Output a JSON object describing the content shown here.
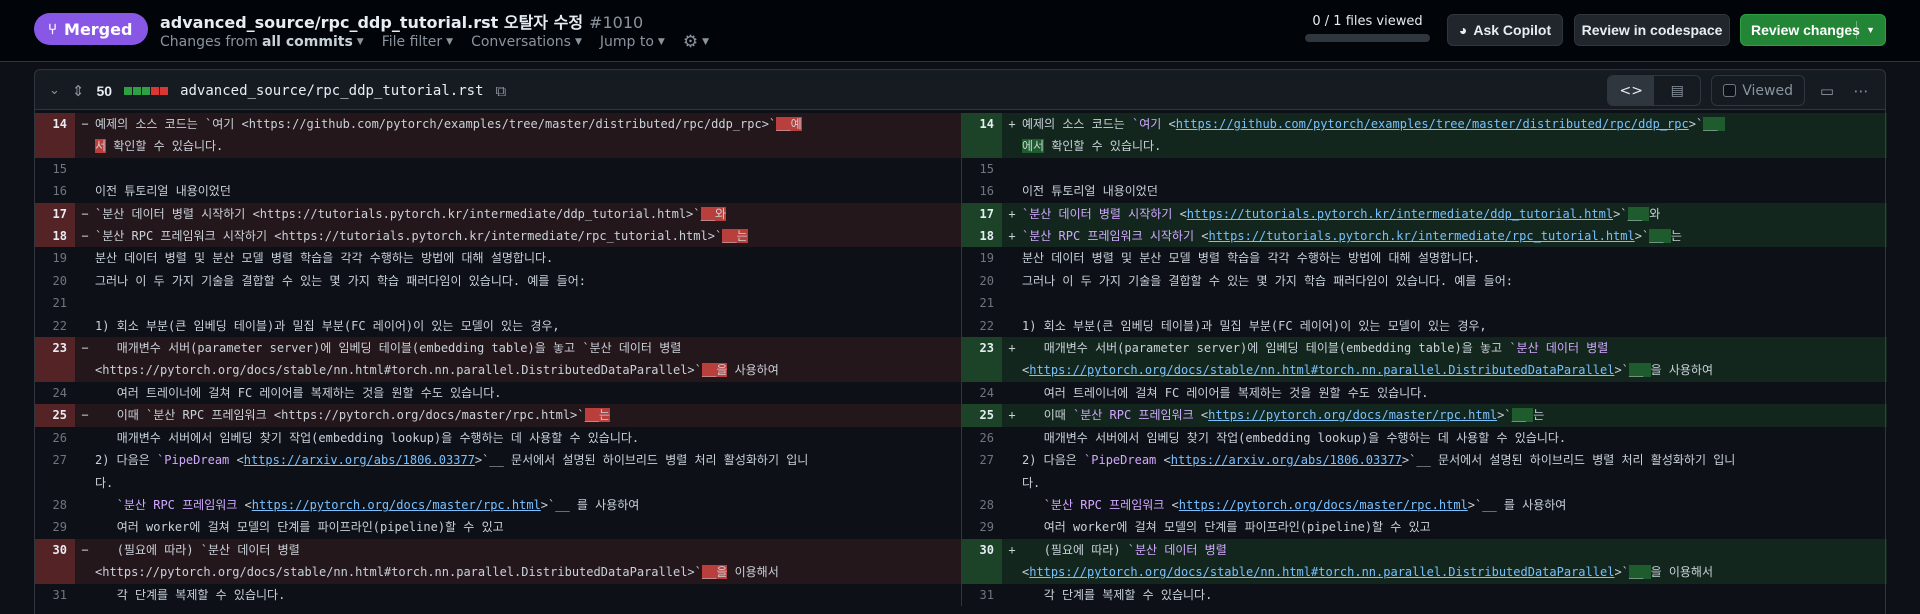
{
  "pr": {
    "status_label": "Merged",
    "title": "advanced_source/rpc_ddp_tutorial.rst 오탈자 수정",
    "number": "#1010",
    "changes_from_prefix": "Changes from",
    "changes_from_value": "all commits",
    "file_filter": "File filter",
    "conversations": "Conversations",
    "jump_to": "Jump to",
    "files_viewed": "0 / 1 files viewed",
    "files_viewed_fraction": 0,
    "ask_copilot": "Ask Copilot",
    "review_codespace": "Review in codespace",
    "review_changes": "Review changes"
  },
  "file": {
    "changes": "50",
    "path": "advanced_source/rpc_ddp_tutorial.rst",
    "viewed_label": "Viewed",
    "diffstat": [
      "#2ea043",
      "#2ea043",
      "#2ea043",
      "#da3633",
      "#da3633"
    ]
  },
  "colors": {
    "merged": "#8957e5",
    "review": "#238636",
    "added": "#2ea043",
    "removed": "#da3633"
  },
  "diff": {
    "left": [
      {
        "num": "14",
        "type": "del",
        "mark": "−",
        "segs": [
          {
            "t": "예제의 소스 코드는 `여기 <https://github.com/pytorch/examples/tree/master/distributed/rpc/ddp_rpc>`"
          },
          {
            "t": "__예",
            "c": "hl-del"
          },
          {
            "t": "\n"
          },
          {
            "t": "서",
            "c": "hl-del"
          },
          {
            "t": " 확인할 수 있습니다."
          }
        ]
      },
      {
        "num": "15",
        "type": "ctx",
        "mark": "",
        "segs": [
          {
            "t": ""
          }
        ]
      },
      {
        "num": "16",
        "type": "ctx",
        "mark": "",
        "segs": [
          {
            "t": "이전 튜토리얼 내용이었던"
          }
        ]
      },
      {
        "num": "17",
        "type": "del",
        "mark": "−",
        "segs": [
          {
            "t": "`분산 데이터 병렬 시작하기 <https://tutorials.pytorch.kr/intermediate/ddp_tutorial.html>`"
          },
          {
            "t": "__와",
            "c": "hl-del"
          }
        ]
      },
      {
        "num": "18",
        "type": "del",
        "mark": "−",
        "segs": [
          {
            "t": "`분산 RPC 프레임워크 시작하기 <https://tutorials.pytorch.kr/intermediate/rpc_tutorial.html>`"
          },
          {
            "t": "__는",
            "c": "hl-del"
          }
        ]
      },
      {
        "num": "19",
        "type": "ctx",
        "mark": "",
        "segs": [
          {
            "t": "분산 데이터 병렬 및 분산 모델 병렬 학습을 각각 수행하는 방법에 대해 설명합니다."
          }
        ]
      },
      {
        "num": "20",
        "type": "ctx",
        "mark": "",
        "segs": [
          {
            "t": "그러나 이 두 가지 기술을 결합할 수 있는 몇 가지 학습 패러다임이 있습니다. 예를 들어:"
          }
        ]
      },
      {
        "num": "21",
        "type": "ctx",
        "mark": "",
        "segs": [
          {
            "t": ""
          }
        ]
      },
      {
        "num": "22",
        "type": "ctx",
        "mark": "",
        "segs": [
          {
            "t": "1) 회소 부분(큰 임베딩 테이블)과 밀집 부분(FC 레이어)이 있는 모델이 있는 경우,"
          }
        ]
      },
      {
        "num": "23",
        "type": "del",
        "mark": "−",
        "segs": [
          {
            "t": "   매개변수 서버(parameter server)에 임베딩 테이블(embedding table)을 놓고 `분산 데이터 병렬\n<https://pytorch.org/docs/stable/nn.html#torch.nn.parallel.DistributedDataParallel>`"
          },
          {
            "t": "__을",
            "c": "hl-del"
          },
          {
            "t": " 사용하여"
          }
        ]
      },
      {
        "num": "24",
        "type": "ctx",
        "mark": "",
        "segs": [
          {
            "t": "   여러 트레이너에 걸쳐 FC 레이어를 복제하는 것을 원할 수도 있습니다."
          }
        ]
      },
      {
        "num": "25",
        "type": "del",
        "mark": "−",
        "segs": [
          {
            "t": "   이때 `분산 RPC 프레임워크 <https://pytorch.org/docs/master/rpc.html>`"
          },
          {
            "t": "__는",
            "c": "hl-del"
          }
        ]
      },
      {
        "num": "26",
        "type": "ctx",
        "mark": "",
        "segs": [
          {
            "t": "   매개변수 서버에서 임베딩 찾기 작업(embedding lookup)을 수행하는 데 사용할 수 있습니다."
          }
        ]
      },
      {
        "num": "27",
        "type": "ctx",
        "mark": "",
        "segs": [
          {
            "t": "2) 다음은 "
          },
          {
            "t": "`PipeDream",
            "c": "str"
          },
          {
            "t": " <"
          },
          {
            "t": "https://arxiv.org/abs/1806.03377",
            "c": "lnk"
          },
          {
            "t": ">`__ 문서에서 설명된 하이브리드 병렬 처리 활성화하기 입니\n다."
          }
        ]
      },
      {
        "num": "28",
        "type": "ctx",
        "mark": "",
        "segs": [
          {
            "t": "   "
          },
          {
            "t": "`분산 RPC 프레임워크",
            "c": "str"
          },
          {
            "t": " <"
          },
          {
            "t": "https://pytorch.org/docs/master/rpc.html",
            "c": "lnk"
          },
          {
            "t": ">`__ 를 사용하여"
          }
        ]
      },
      {
        "num": "29",
        "type": "ctx",
        "mark": "",
        "segs": [
          {
            "t": "   여러 worker에 걸쳐 모델의 단계를 파이프라인(pipeline)할 수 있고"
          }
        ]
      },
      {
        "num": "30",
        "type": "del",
        "mark": "−",
        "segs": [
          {
            "t": "   (필요에 따라) `분산 데이터 병렬\n<https://pytorch.org/docs/stable/nn.html#torch.nn.parallel.DistributedDataParallel>`"
          },
          {
            "t": "__을",
            "c": "hl-del"
          },
          {
            "t": " 이용해서"
          }
        ]
      },
      {
        "num": "31",
        "type": "ctx",
        "mark": "",
        "segs": [
          {
            "t": "   각 단계를 복제할 수 있습니다."
          }
        ]
      }
    ],
    "right": [
      {
        "num": "14",
        "type": "add",
        "mark": "+",
        "segs": [
          {
            "t": "예제의 소스 코드는 "
          },
          {
            "t": "`여기",
            "c": "str"
          },
          {
            "t": " <"
          },
          {
            "t": "https://github.com/pytorch/examples/tree/master/distributed/rpc/ddp_rpc",
            "c": "lnk"
          },
          {
            "t": ">`"
          },
          {
            "t": "__ ",
            "c": "hl-add"
          },
          {
            "t": "\n"
          },
          {
            "t": "에서",
            "c": "hl-add"
          },
          {
            "t": " 확인할 수 있습니다."
          }
        ]
      },
      {
        "num": "15",
        "type": "ctx",
        "mark": "",
        "segs": [
          {
            "t": ""
          }
        ]
      },
      {
        "num": "16",
        "type": "ctx",
        "mark": "",
        "segs": [
          {
            "t": "이전 튜토리얼 내용이었던"
          }
        ]
      },
      {
        "num": "17",
        "type": "add",
        "mark": "+",
        "segs": [
          {
            "t": "`분산 데이터 병렬 시작하기",
            "c": "str"
          },
          {
            "t": " <"
          },
          {
            "t": "https://tutorials.pytorch.kr/intermediate/ddp_tutorial.html",
            "c": "lnk"
          },
          {
            "t": ">`"
          },
          {
            "t": "__ ",
            "c": "hl-add"
          },
          {
            "t": "와"
          }
        ]
      },
      {
        "num": "18",
        "type": "add",
        "mark": "+",
        "segs": [
          {
            "t": "`분산 RPC 프레임워크 시작하기",
            "c": "str"
          },
          {
            "t": " <"
          },
          {
            "t": "https://tutorials.pytorch.kr/intermediate/rpc_tutorial.html",
            "c": "lnk"
          },
          {
            "t": ">`"
          },
          {
            "t": "__ ",
            "c": "hl-add"
          },
          {
            "t": "는"
          }
        ]
      },
      {
        "num": "19",
        "type": "ctx",
        "mark": "",
        "segs": [
          {
            "t": "분산 데이터 병렬 및 분산 모델 병렬 학습을 각각 수행하는 방법에 대해 설명합니다."
          }
        ]
      },
      {
        "num": "20",
        "type": "ctx",
        "mark": "",
        "segs": [
          {
            "t": "그러나 이 두 가지 기술을 결합할 수 있는 몇 가지 학습 패러다임이 있습니다. 예를 들어:"
          }
        ]
      },
      {
        "num": "21",
        "type": "ctx",
        "mark": "",
        "segs": [
          {
            "t": ""
          }
        ]
      },
      {
        "num": "22",
        "type": "ctx",
        "mark": "",
        "segs": [
          {
            "t": "1) 회소 부분(큰 임베딩 테이블)과 밀집 부분(FC 레이어)이 있는 모델이 있는 경우,"
          }
        ]
      },
      {
        "num": "23",
        "type": "add",
        "mark": "+",
        "segs": [
          {
            "t": "   매개변수 서버(parameter server)에 임베딩 테이블(embedding table)을 놓고 "
          },
          {
            "t": "`분산 데이터 병렬",
            "c": "str"
          },
          {
            "t": "\n<"
          },
          {
            "t": "https://pytorch.org/docs/stable/nn.html#torch.nn.parallel.DistributedDataParallel",
            "c": "lnk"
          },
          {
            "t": ">`"
          },
          {
            "t": "__ ",
            "c": "hl-add"
          },
          {
            "t": "을 사용하여"
          }
        ]
      },
      {
        "num": "24",
        "type": "ctx",
        "mark": "",
        "segs": [
          {
            "t": "   여러 트레이너에 걸쳐 FC 레이어를 복제하는 것을 원할 수도 있습니다."
          }
        ]
      },
      {
        "num": "25",
        "type": "add",
        "mark": "+",
        "segs": [
          {
            "t": "   이때 "
          },
          {
            "t": "`분산 RPC 프레임워크",
            "c": "str"
          },
          {
            "t": " <"
          },
          {
            "t": "https://pytorch.org/docs/master/rpc.html",
            "c": "lnk"
          },
          {
            "t": ">`"
          },
          {
            "t": "__ ",
            "c": "hl-add"
          },
          {
            "t": "는"
          }
        ]
      },
      {
        "num": "26",
        "type": "ctx",
        "mark": "",
        "segs": [
          {
            "t": "   매개변수 서버에서 임베딩 찾기 작업(embedding lookup)을 수행하는 데 사용할 수 있습니다."
          }
        ]
      },
      {
        "num": "27",
        "type": "ctx",
        "mark": "",
        "segs": [
          {
            "t": "2) 다음은 "
          },
          {
            "t": "`PipeDream",
            "c": "str"
          },
          {
            "t": " <"
          },
          {
            "t": "https://arxiv.org/abs/1806.03377",
            "c": "lnk"
          },
          {
            "t": ">`__ 문서에서 설명된 하이브리드 병렬 처리 활성화하기 입니\n다."
          }
        ]
      },
      {
        "num": "28",
        "type": "ctx",
        "mark": "",
        "segs": [
          {
            "t": "   "
          },
          {
            "t": "`분산 RPC 프레임워크",
            "c": "str"
          },
          {
            "t": " <"
          },
          {
            "t": "https://pytorch.org/docs/master/rpc.html",
            "c": "lnk"
          },
          {
            "t": ">`__ 를 사용하여"
          }
        ]
      },
      {
        "num": "29",
        "type": "ctx",
        "mark": "",
        "segs": [
          {
            "t": "   여러 worker에 걸쳐 모델의 단계를 파이프라인(pipeline)할 수 있고"
          }
        ]
      },
      {
        "num": "30",
        "type": "add",
        "mark": "+",
        "segs": [
          {
            "t": "   (필요에 따라) "
          },
          {
            "t": "`분산 데이터 병렬",
            "c": "str"
          },
          {
            "t": "\n<"
          },
          {
            "t": "https://pytorch.org/docs/stable/nn.html#torch.nn.parallel.DistributedDataParallel",
            "c": "lnk"
          },
          {
            "t": ">`"
          },
          {
            "t": "__ ",
            "c": "hl-add"
          },
          {
            "t": "을 이용해서"
          }
        ]
      },
      {
        "num": "31",
        "type": "ctx",
        "mark": "",
        "segs": [
          {
            "t": "   각 단계를 복제할 수 있습니다."
          }
        ]
      }
    ]
  }
}
